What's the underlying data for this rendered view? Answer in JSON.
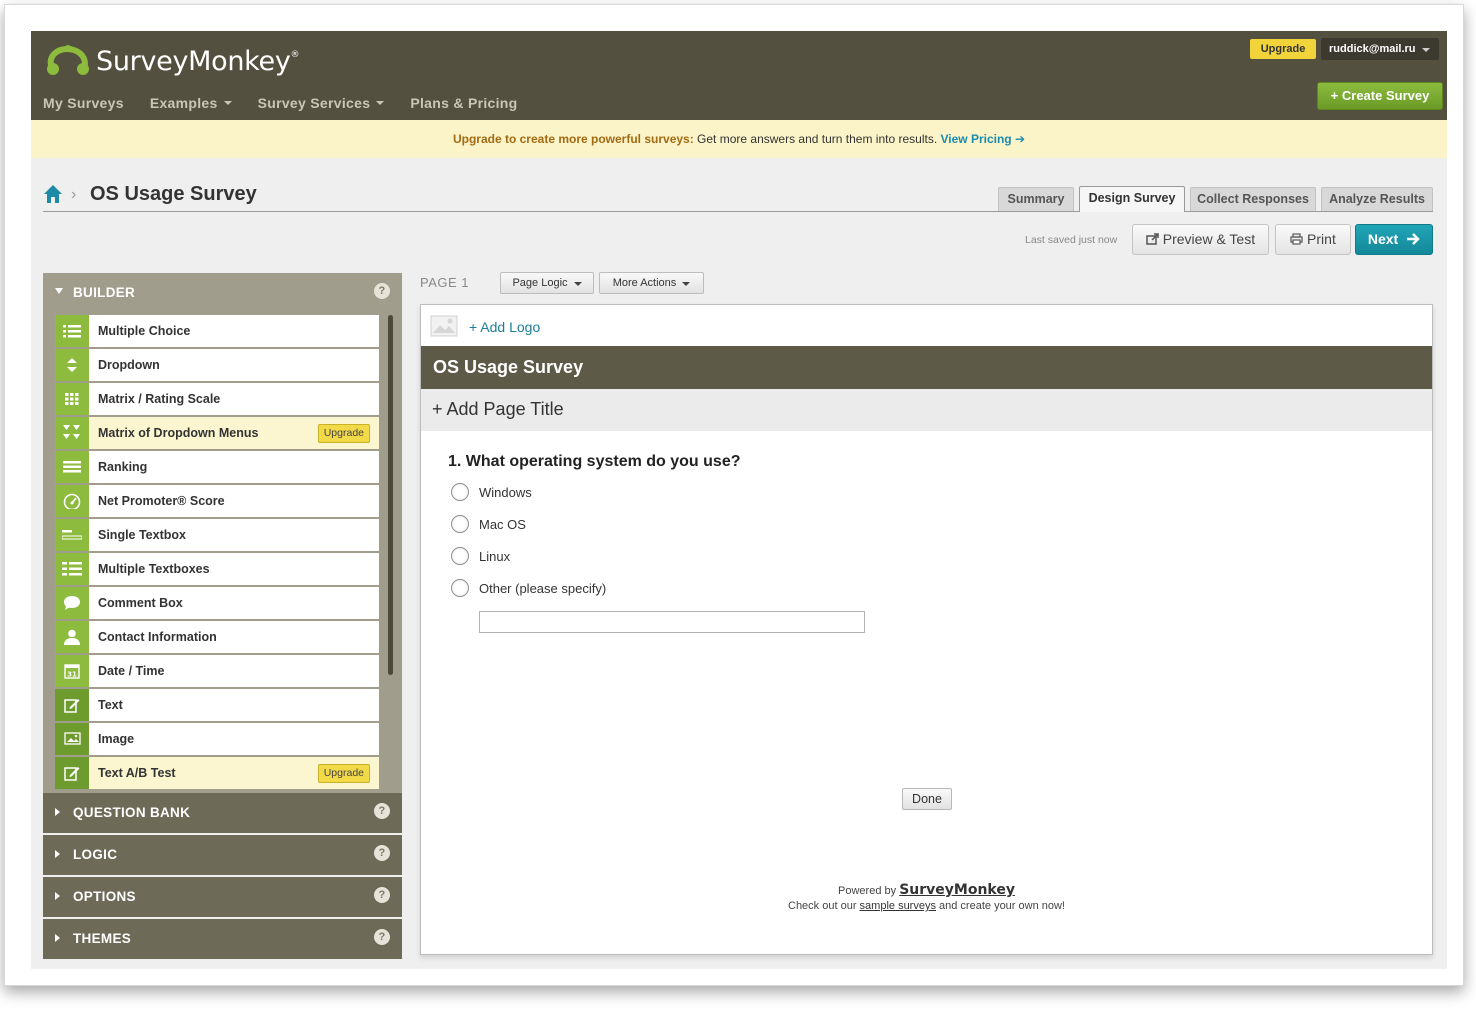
{
  "header": {
    "brand": "SurveyMonkey",
    "brand_mark": "®",
    "nav": [
      "My Surveys",
      "Examples",
      "Survey Services",
      "Plans & Pricing"
    ],
    "upgrade_label": "Upgrade",
    "user_email": "ruddick@mail.ru",
    "create_label": "+ Create Survey"
  },
  "promo": {
    "lead": "Upgrade to create more powerful surveys:",
    "text": " Get more answers and turn them into results. ",
    "link": "View Pricing ➔"
  },
  "survey": {
    "breadcrumb_sep": "›",
    "title": "OS Usage Survey"
  },
  "tabs": [
    "Summary",
    "Design Survey",
    "Collect Responses",
    "Analyze Results"
  ],
  "active_tab": "Design Survey",
  "toolbar": {
    "saved": "Last saved just now",
    "preview": "Preview & Test",
    "print": "Print",
    "next": "Next"
  },
  "builder": {
    "title": "BUILDER",
    "help": "?",
    "items": [
      {
        "label": "Multiple Choice",
        "icon": "list-icon"
      },
      {
        "label": "Dropdown",
        "icon": "updown-icon"
      },
      {
        "label": "Matrix / Rating Scale",
        "icon": "grid-icon"
      },
      {
        "label": "Matrix of Dropdown Menus",
        "icon": "matrix-dropdown-icon",
        "upgrade": "Upgrade"
      },
      {
        "label": "Ranking",
        "icon": "ranking-icon"
      },
      {
        "label": "Net Promoter® Score",
        "icon": "gauge-icon"
      },
      {
        "label": "Single Textbox",
        "icon": "textbox-icon"
      },
      {
        "label": "Multiple Textboxes",
        "icon": "textboxes-icon"
      },
      {
        "label": "Comment Box",
        "icon": "speech-bubble-icon"
      },
      {
        "label": "Contact Information",
        "icon": "person-icon"
      },
      {
        "label": "Date / Time",
        "icon": "calendar-icon"
      },
      {
        "label": "Text",
        "icon": "edit-icon"
      },
      {
        "label": "Image",
        "icon": "image-icon"
      },
      {
        "label": "Text A/B Test",
        "icon": "edit-icon",
        "upgrade": "Upgrade"
      }
    ]
  },
  "panels": [
    "QUESTION BANK",
    "LOGIC",
    "OPTIONS",
    "THEMES"
  ],
  "page": {
    "label": "PAGE 1",
    "page_logic": "Page Logic",
    "more_actions": "More Actions",
    "add_logo": "+ Add Logo",
    "survey_band": "OS Usage Survey",
    "add_page_title": "+ Add Page Title",
    "question": "1. What operating system do you use?",
    "options": [
      "Windows",
      "Mac OS",
      "Linux",
      "Other (please specify)"
    ],
    "done": "Done",
    "powered_prefix": "Powered by ",
    "powered_brand": "SurveyMonkey",
    "checkout_prefix": "Check out our ",
    "checkout_link": "sample surveys",
    "checkout_suffix": " and create your own now!"
  },
  "colors": {
    "header": "#54503f",
    "accent_green": "#8cbb3e",
    "next_teal": "#13899a",
    "promo_bg": "#fbf4c8",
    "upgrade_yellow": "#f1d948"
  }
}
